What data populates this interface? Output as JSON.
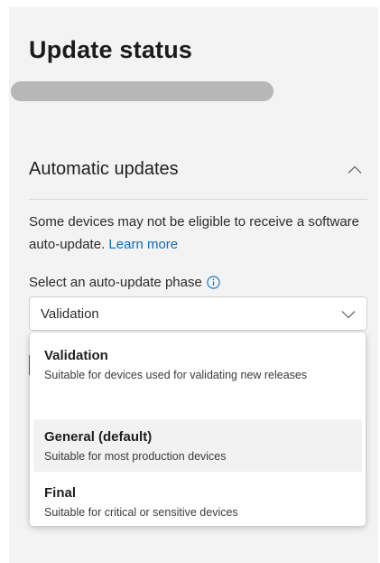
{
  "page": {
    "title": "Update status"
  },
  "section": {
    "title": "Automatic updates",
    "description": "Some devices may not be eligible to receive a software auto-update.",
    "learn_more": "Learn more"
  },
  "phase": {
    "label": "Select an auto-update phase",
    "selected_value": "Validation",
    "options": [
      {
        "title": "Validation",
        "description": "Suitable for devices used for validating new releases"
      },
      {
        "title": "General (default)",
        "description": "Suitable for most production devices"
      },
      {
        "title": "Final",
        "description": "Suitable for critical or sensitive devices"
      }
    ]
  },
  "colors": {
    "panel_bg": "#f3f3f3",
    "link": "#0f6cbd",
    "info_icon": "#0f6cbd",
    "highlight_row": "#f2f2f2",
    "redacted": "#b7b7b7"
  },
  "icons": {
    "collapse": "chevron-up-icon",
    "info": "info-icon",
    "dropdown": "chevron-down-icon"
  }
}
